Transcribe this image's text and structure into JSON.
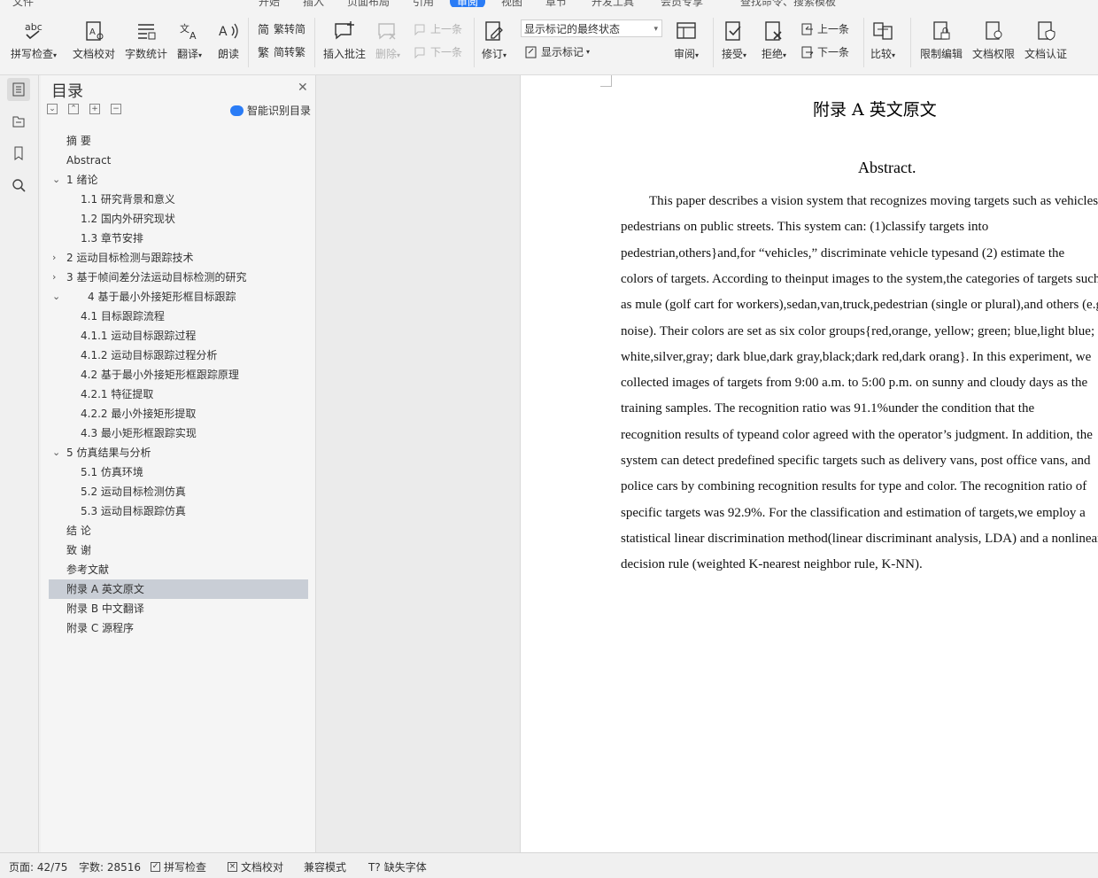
{
  "menu_tabs": [
    "文件",
    "开始",
    "插入",
    "页面布局",
    "引用",
    "审阅",
    "视图",
    "章节",
    "开发工具",
    "会员专享",
    "查找命令、搜索模板"
  ],
  "ribbon": {
    "spell_check": "拼写检查",
    "doc_proof": "文档校对",
    "word_count": "字数统计",
    "translate": "翻译",
    "read_aloud": "朗读",
    "trad_to_simp": "繁转简",
    "simp_to_trad": "简转繁",
    "insert_comment": "插入批注",
    "delete": "删除",
    "prev_comment": "上一条",
    "next_comment": "下一条",
    "track_changes": "修订",
    "markup_state": "显示标记的最终状态",
    "show_markup": "显示标记",
    "review": "审阅",
    "accept": "接受",
    "reject": "拒绝",
    "prev_change": "上一条",
    "next_change": "下一条",
    "compare": "比较",
    "restrict_edit": "限制编辑",
    "doc_permission": "文档权限",
    "doc_auth": "文档认证"
  },
  "toc": {
    "title": "目录",
    "smart_label": "智能识别目录",
    "items": [
      {
        "text": "摘  要",
        "level": 0,
        "arrow": ""
      },
      {
        "text": "Abstract",
        "level": 0,
        "arrow": ""
      },
      {
        "text": "1    绪论",
        "level": 0,
        "arrow": "down"
      },
      {
        "text": "1.1    研究背景和意义",
        "level": 1,
        "arrow": ""
      },
      {
        "text": "1.2    国内外研究现状",
        "level": 1,
        "arrow": ""
      },
      {
        "text": "1.3    章节安排",
        "level": 1,
        "arrow": ""
      },
      {
        "text": "2    运动目标检测与跟踪技术",
        "level": 0,
        "arrow": "right"
      },
      {
        "text": "3    基于帧间差分法运动目标检测的研究",
        "level": 0,
        "arrow": "right"
      },
      {
        "text": "4    基于最小外接矩形框目标跟踪",
        "level": 0,
        "arrow": "down",
        "indent": true
      },
      {
        "text": "4.1    目标跟踪流程",
        "level": 1,
        "arrow": ""
      },
      {
        "text": "4.1.1    运动目标跟踪过程",
        "level": 1,
        "arrow": ""
      },
      {
        "text": "4.1.2    运动目标跟踪过程分析",
        "level": 1,
        "arrow": ""
      },
      {
        "text": "4.2    基于最小外接矩形框跟踪原理",
        "level": 1,
        "arrow": ""
      },
      {
        "text": "4.2.1    特征提取",
        "level": 1,
        "arrow": ""
      },
      {
        "text": "4.2.2    最小外接矩形提取",
        "level": 1,
        "arrow": ""
      },
      {
        "text": "4.3    最小矩形框跟踪实现",
        "level": 1,
        "arrow": ""
      },
      {
        "text": "5    仿真结果与分析",
        "level": 0,
        "arrow": "down"
      },
      {
        "text": "5.1    仿真环境",
        "level": 1,
        "arrow": ""
      },
      {
        "text": "5.2    运动目标检测仿真",
        "level": 1,
        "arrow": ""
      },
      {
        "text": "5.3    运动目标跟踪仿真",
        "level": 1,
        "arrow": ""
      },
      {
        "text": "结  论",
        "level": 0,
        "arrow": ""
      },
      {
        "text": "致  谢",
        "level": 0,
        "arrow": ""
      },
      {
        "text": "参考文献",
        "level": 0,
        "arrow": ""
      },
      {
        "text": "附录 A    英文原文",
        "level": 0,
        "arrow": "",
        "selected": true
      },
      {
        "text": "附录 B    中文翻译",
        "level": 0,
        "arrow": ""
      },
      {
        "text": "附录 C    源程序",
        "level": 0,
        "arrow": ""
      }
    ]
  },
  "document": {
    "heading": "附录 A    英文原文",
    "subheading": "Abstract.",
    "lines": [
      "This paper describes a vision system that recognizes moving targets such as vehicles and",
      "pedestrians    on    public    streets.    This    system    can:    (1)classify    targets    into",
      "pedestrian,others}and,for “vehicles,” discriminate vehicle typesand (2) estimate the",
      "colors of targets. According to theinput images to the system,the categories of targets such",
      "as mule (golf cart for workers),sedan,van,truck,pedestrian (single or plural),and others (e.g.",
      "noise). Their colors are set as six color groups{red,orange, yellow; green; blue,light blue;",
      "white,silver,gray; dark blue,dark gray,black;dark red,dark orang}. In this experiment, we",
      "collected images of targets from 9:00 a.m. to 5:00 p.m. on sunny and cloudy days as the",
      "training samples. The recognition ratio was 91.1%under the condition that the",
      "recognition results of typeand color agreed with the operator’s judgment. In addition, the",
      "system can detect predefined specific targets such as delivery vans, post office vans, and",
      "police cars by combining recognition results for type and color. The recognition ratio of",
      "specific targets was 92.9%. For the classification and estimation of targets,we employ a",
      "statistical linear discrimination method(linear discriminant analysis, LDA) and a nonlinear",
      "decision rule (weighted K-nearest neighbor rule, K-NN)."
    ]
  },
  "status_bar": {
    "page": "页面: 42/75",
    "words": "字数: 28516",
    "spell_check": "拼写检查",
    "doc_proof": "文档校对",
    "compat_mode": "兼容模式",
    "missing_fonts": "缺失字体"
  },
  "colors": {
    "accent": "#2a7cf6",
    "selected_row": "#c9ced6"
  }
}
